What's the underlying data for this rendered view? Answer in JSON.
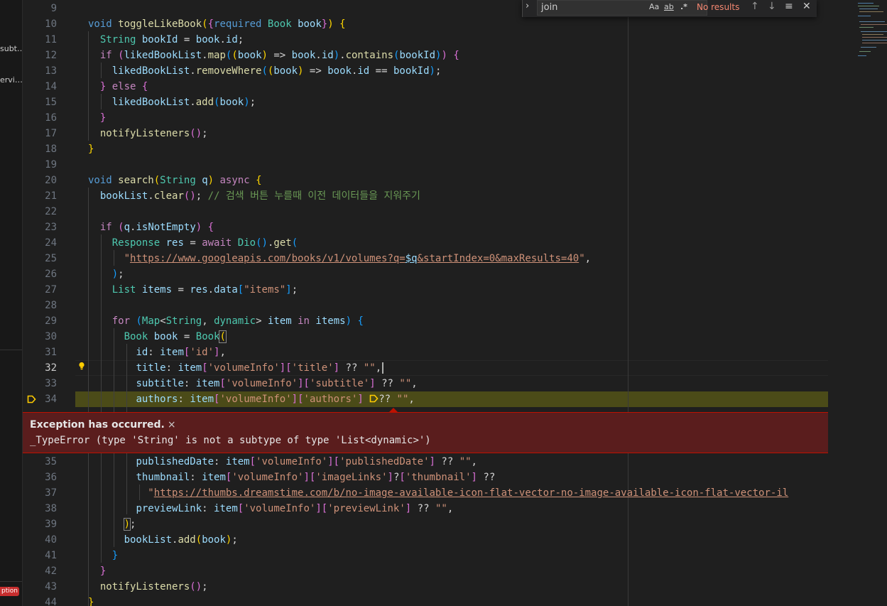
{
  "sidebar": {
    "fragment_1": "subt…",
    "fragment_2": "ervi…",
    "badge": "ption"
  },
  "find_widget": {
    "query": "join",
    "opt_case": "Aa",
    "opt_word": "ab",
    "opt_regex": ".*",
    "status": "No results",
    "prev_icon": "arrow-up-icon",
    "next_icon": "arrow-down-icon",
    "selection_icon": "find-in-selection-icon",
    "close_icon": "close-icon"
  },
  "exception": {
    "title": "Exception has occurred.",
    "close": "×",
    "message": "_TypeError (type 'String' is not a subtype of type 'List<dynamic>')"
  },
  "line_numbers": [
    "9",
    "10",
    "11",
    "12",
    "13",
    "14",
    "15",
    "16",
    "17",
    "18",
    "19",
    "20",
    "21",
    "22",
    "23",
    "24",
    "25",
    "26",
    "27",
    "28",
    "29",
    "30",
    "31",
    "32",
    "33",
    "34",
    "35",
    "36",
    "37",
    "38",
    "39",
    "40",
    "41",
    "42",
    "43",
    "44"
  ],
  "colors": {
    "editor_bg": "#1f1f1f",
    "exception_bg": "#5a1d1d",
    "exception_border": "#be1100",
    "debug_line_bg": "#4b4b18",
    "no_results": "#f48771"
  },
  "code": {
    "l10": [
      "void",
      "toggleLikeBook",
      "(",
      "{",
      "required",
      "Book",
      "book",
      "}",
      ")",
      "{"
    ],
    "l11": [
      "String",
      "bookId",
      "=",
      "book",
      ".",
      "id",
      ";"
    ],
    "l12": [
      "if",
      "(",
      "likedBookList",
      ".",
      "map",
      "(",
      "(",
      "book",
      ")",
      "=>",
      "book",
      ".",
      "id",
      ")",
      ".",
      "contains",
      "(",
      "bookId",
      ")",
      ")",
      "{"
    ],
    "l13": [
      "likedBookList",
      ".",
      "removeWhere",
      "(",
      "(",
      "book",
      ")",
      "=>",
      "book",
      ".",
      "id",
      "==",
      "bookId",
      ")",
      ";"
    ],
    "l14": [
      "}",
      "else",
      "{"
    ],
    "l15": [
      "likedBookList",
      ".",
      "add",
      "(",
      "book",
      ")",
      ";"
    ],
    "l16": [
      "}"
    ],
    "l17": [
      "notifyListeners",
      "(",
      ")",
      ";"
    ],
    "l18": [
      "}"
    ],
    "l20": [
      "void",
      "search",
      "(",
      "String",
      "q",
      ")",
      "async",
      "{"
    ],
    "l21": [
      "bookList",
      ".",
      "clear",
      "(",
      ")",
      ";",
      "// 검색 버튼 누를때 이전 데이터들을 지워주기"
    ],
    "l23": [
      "if",
      "(",
      "q",
      ".",
      "isNotEmpty",
      ")",
      "{"
    ],
    "l24": [
      "Response",
      "res",
      "=",
      "await",
      "Dio",
      "(",
      ")",
      ".",
      "get",
      "("
    ],
    "l25": [
      "\"",
      "https://www.googleapis.com/books/v1/volumes?q=",
      "$q",
      "&startIndex=0&maxResults=40",
      "\"",
      ","
    ],
    "l26": [
      ")",
      ";"
    ],
    "l27": [
      "List",
      "items",
      "=",
      "res",
      ".",
      "data",
      "[",
      "\"items\"",
      "]",
      ";"
    ],
    "l29": [
      "for",
      "(",
      "Map",
      "<",
      "String",
      ",",
      "dynamic",
      ">",
      "item",
      "in",
      "items",
      ")",
      "{"
    ],
    "l30": [
      "Book",
      "book",
      "=",
      "Book",
      "("
    ],
    "l31": [
      "id",
      ":",
      "item",
      "[",
      "'id'",
      "]",
      ","
    ],
    "l32": [
      "title",
      ":",
      "item",
      "[",
      "'volumeInfo'",
      "]",
      "[",
      "'title'",
      "]",
      "??",
      "\"\"",
      ","
    ],
    "l33": [
      "subtitle",
      ":",
      "item",
      "[",
      "'volumeInfo'",
      "]",
      "[",
      "'subtitle'",
      "]",
      "??",
      "\"\"",
      ","
    ],
    "l34": [
      "authors",
      ":",
      "item",
      "[",
      "'volumeInfo'",
      "]",
      "[",
      "'authors'",
      "]",
      "??",
      "\"\"",
      ","
    ],
    "l35": [
      "publishedDate",
      ":",
      "item",
      "[",
      "'volumeInfo'",
      "]",
      "[",
      "'publishedDate'",
      "]",
      "??",
      "\"\"",
      ","
    ],
    "l36": [
      "thumbnail",
      ":",
      "item",
      "[",
      "'volumeInfo'",
      "]",
      "[",
      "'imageLinks'",
      "]",
      "?",
      "[",
      "'thumbnail'",
      "]",
      "??"
    ],
    "l37": [
      "\"",
      "https://thumbs.dreamstime.com/b/no-image-available-icon-flat-vector-no-image-available-icon-flat-vector-il"
    ],
    "l38": [
      "previewLink",
      ":",
      "item",
      "[",
      "'volumeInfo'",
      "]",
      "[",
      "'previewLink'",
      "]",
      "??",
      "\"\"",
      ","
    ],
    "l39": [
      ")",
      ";"
    ],
    "l40": [
      "bookList",
      ".",
      "add",
      "(",
      "book",
      ")",
      ";"
    ],
    "l41": [
      "}"
    ],
    "l42": [
      "}"
    ],
    "l43": [
      "notifyListeners",
      "(",
      ")",
      ";"
    ],
    "l44": [
      "}"
    ]
  }
}
